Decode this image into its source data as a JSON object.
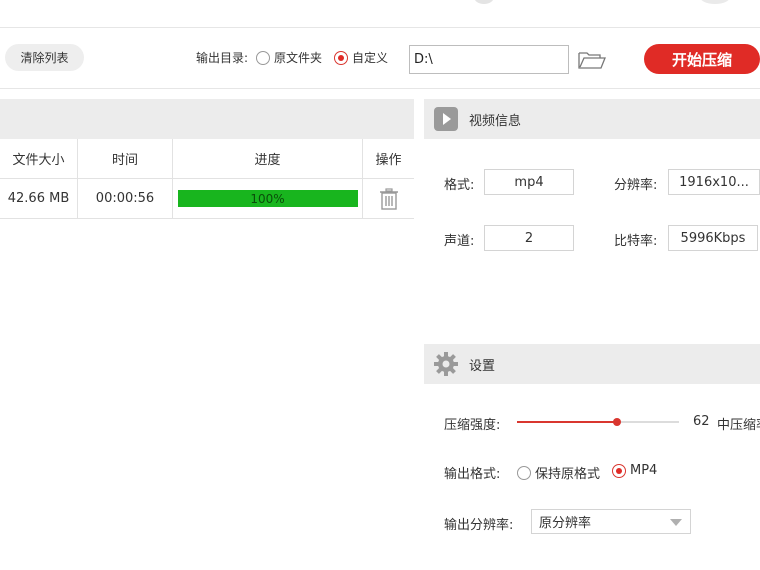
{
  "toolbar": {
    "clear_label": "清除列表",
    "output_dir_label": "输出目录:",
    "radio_original": "原文件夹",
    "radio_custom": "自定义",
    "output_path": "D:\\",
    "start_label": "开始压缩"
  },
  "table": {
    "columns": [
      "文件大小",
      "时间",
      "进度",
      "操作"
    ],
    "rows": [
      {
        "size": "42.66 MB",
        "time": "00:00:56",
        "progress_text": "100%",
        "progress": 100
      }
    ]
  },
  "video_info": {
    "title": "视频信息",
    "format_label": "格式:",
    "format_value": "mp4",
    "resolution_label": "分辨率:",
    "resolution_value": "1916x10...",
    "channels_label": "声道:",
    "channels_value": "2",
    "bitrate_label": "比特率:",
    "bitrate_value": "5996Kbps"
  },
  "settings": {
    "title": "设置",
    "strength_label": "压缩强度:",
    "strength_value": "62",
    "strength_desc": "中压缩率",
    "format_label": "输出格式:",
    "format_keep": "保持原格式",
    "format_mp4": "MP4",
    "resolution_label": "输出分辨率:",
    "resolution_selected": "原分辨率"
  },
  "colors": {
    "accent": "#e02b26",
    "progress": "#18b51e",
    "panel": "#ececec"
  },
  "icons": [
    "folder-open-icon",
    "trash-icon",
    "play-icon",
    "gear-icon"
  ]
}
